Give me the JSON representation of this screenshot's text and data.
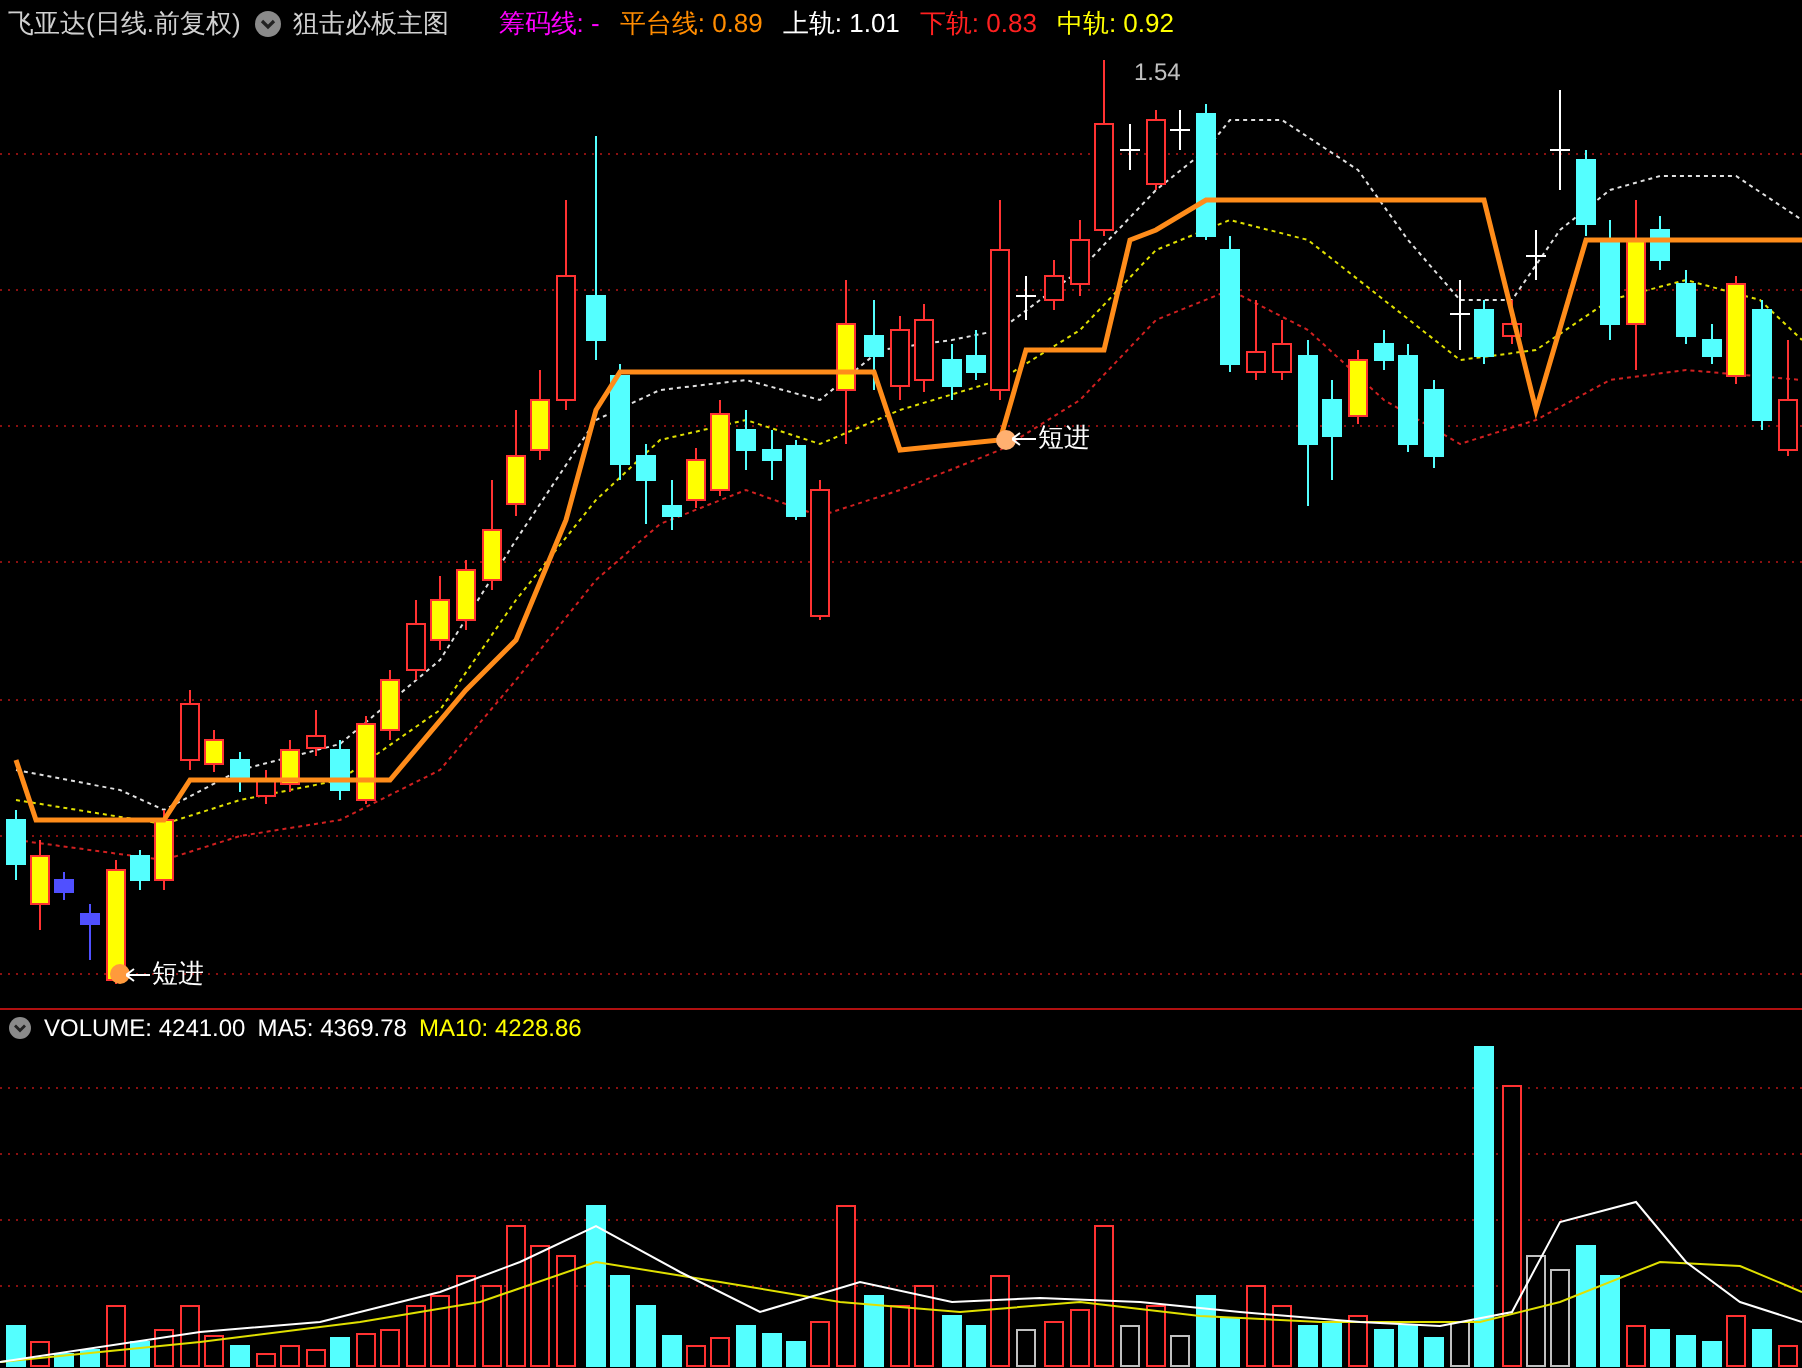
{
  "header": {
    "title": "飞亚达(日线.前复权)",
    "indicator": "狙击必板主图",
    "legend": [
      {
        "label": "筹码线:",
        "value": "-",
        "color": "#ff00ff"
      },
      {
        "label": "平台线:",
        "value": "0.89",
        "color": "#ff8c00"
      },
      {
        "label": "上轨:",
        "value": "1.01",
        "color": "#ffffff"
      },
      {
        "label": "下轨:",
        "value": "0.83",
        "color": "#ff2020"
      },
      {
        "label": "中轨:",
        "value": "0.92",
        "color": "#ffff00"
      }
    ]
  },
  "chart": {
    "price_label": "1.54",
    "markers": [
      {
        "label": "短进"
      },
      {
        "label": "短进"
      }
    ]
  },
  "volume_header": {
    "items": [
      {
        "label": "VOLUME:",
        "value": "4241.00",
        "color": "#ffffff"
      },
      {
        "label": "MA5:",
        "value": "4369.78",
        "color": "#ffffff"
      },
      {
        "label": "MA10:",
        "value": "4228.86",
        "color": "#ffff00"
      }
    ]
  }
}
